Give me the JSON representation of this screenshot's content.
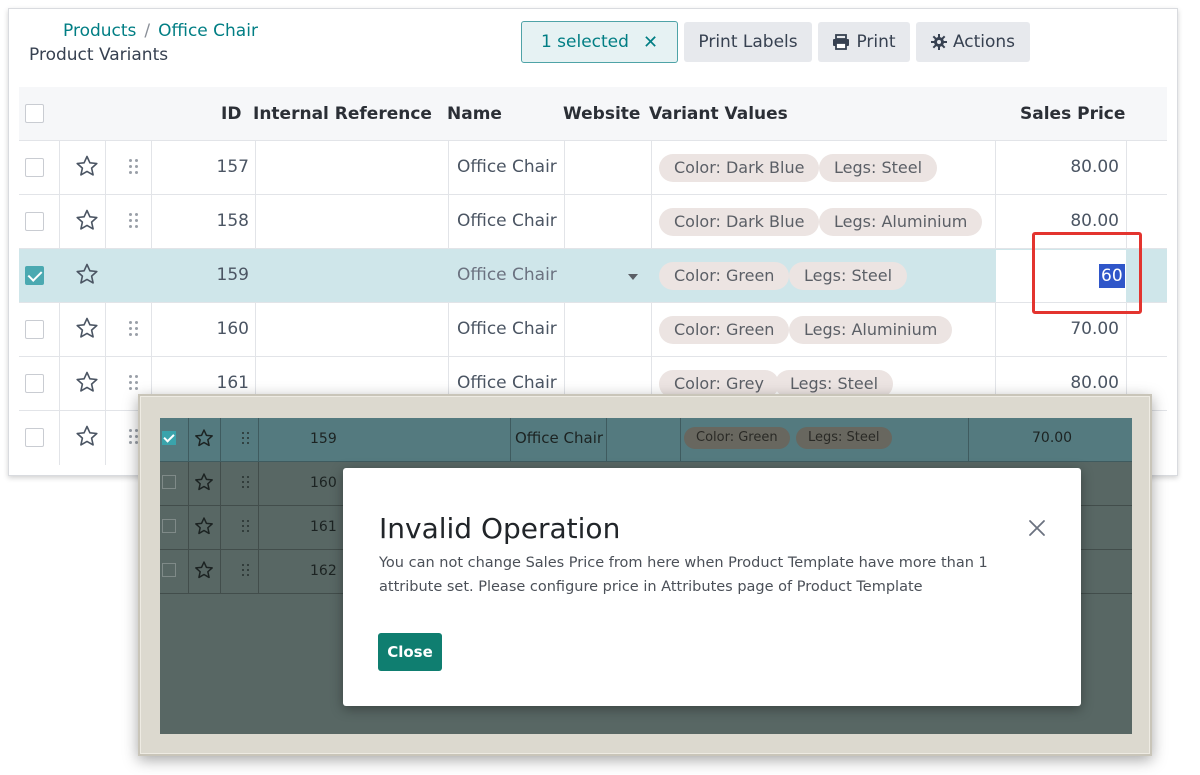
{
  "breadcrumb": {
    "parent": "Products",
    "separator": "/",
    "current": "Office Chair"
  },
  "subtitle": "Product Variants",
  "toolbar": {
    "selected_label": "1 selected",
    "clear_icon": "close-icon",
    "print_labels": "Print Labels",
    "print": "Print",
    "actions": "Actions"
  },
  "table": {
    "columns": {
      "id": "ID",
      "internal_reference": "Internal Reference",
      "name": "Name",
      "website": "Website",
      "variant_values": "Variant Values",
      "sales_price": "Sales Price"
    },
    "rows": [
      {
        "id": "157",
        "name": "Office Chair",
        "color": "Color: Dark Blue",
        "legs": "Legs: Steel",
        "price": "80.00"
      },
      {
        "id": "158",
        "name": "Office Chair",
        "color": "Color: Dark Blue",
        "legs": "Legs: Aluminium",
        "price": "80.00"
      },
      {
        "id": "159",
        "name": "Office Chair",
        "color": "Color: Green",
        "legs": "Legs: Steel",
        "price": "60"
      },
      {
        "id": "160",
        "name": "Office Chair",
        "color": "Color: Green",
        "legs": "Legs: Aluminium",
        "price": "70.00"
      },
      {
        "id": "161",
        "name": "Office Chair",
        "color": "Color: Grey",
        "legs": "Legs: Steel",
        "price": "80.00"
      }
    ]
  },
  "background_rows": [
    {
      "id": "159",
      "name": "Office Chair",
      "color": "Color: Green",
      "legs": "Legs: Steel",
      "price": "70.00"
    },
    {
      "id": "160"
    },
    {
      "id": "161"
    },
    {
      "id": "162"
    }
  ],
  "dialog": {
    "title": "Invalid Operation",
    "message": "You can not change Sales Price from here when Product Template have more than 1 attribute set. Please configure price in Attributes page of Product Template",
    "close_button": "Close"
  },
  "colors": {
    "accent": "#017e84",
    "selected_row": "#cfe6ea",
    "highlight_box": "#e3342f",
    "dialog_button": "#0f7e70"
  }
}
